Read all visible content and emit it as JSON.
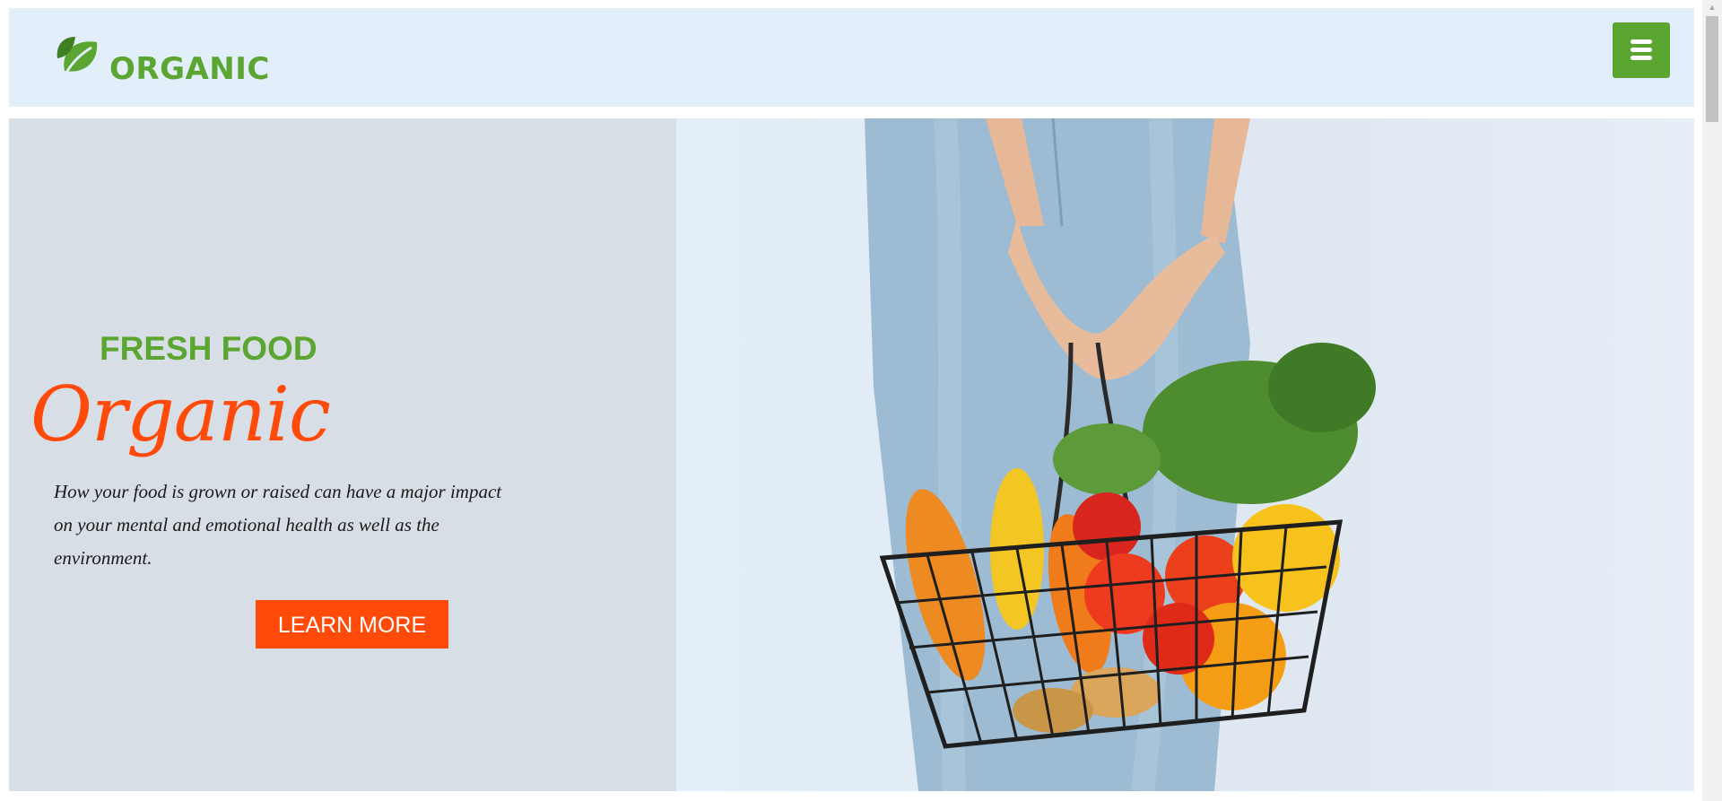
{
  "header": {
    "logo_text": "ORGANIC",
    "menu_icon": "hamburger-menu-icon"
  },
  "hero": {
    "kicker": "FRESH FOOD",
    "title": "Organic",
    "description": "How your food is grown or raised can have a major impact on your mental and emotional health as well as the environment.",
    "cta_label": "LEARN MORE",
    "image": "woman-holding-vegetable-basket"
  },
  "colors": {
    "brand_green": "#5ba531",
    "accent_orange": "#ff4a0a",
    "header_bg": "#e2eefa",
    "hero_bg": "#d7dee5"
  }
}
